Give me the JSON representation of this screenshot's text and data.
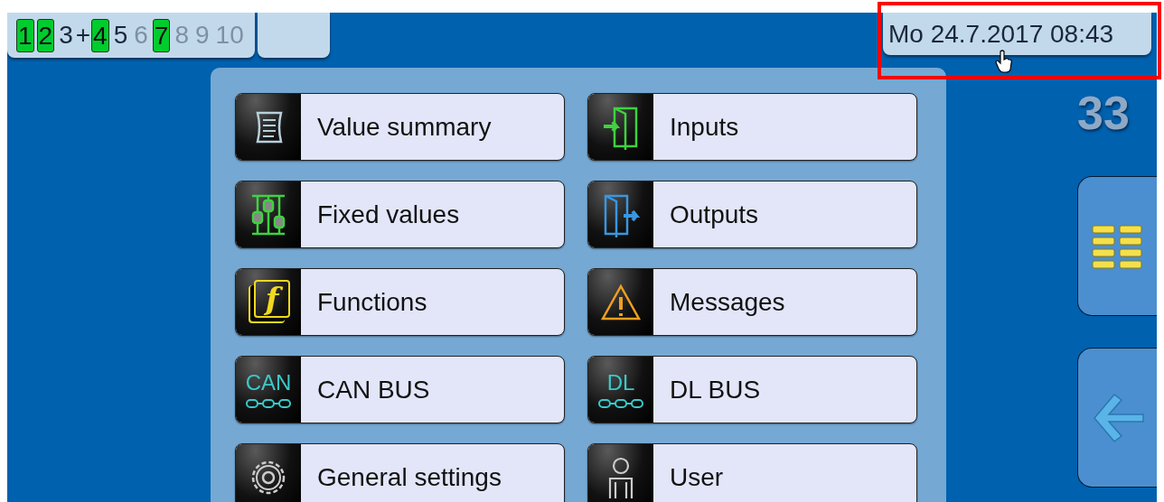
{
  "channels": [
    {
      "label": "1",
      "kind": "active"
    },
    {
      "label": "2",
      "kind": "active"
    },
    {
      "label": "3",
      "kind": "present"
    },
    {
      "label": "+",
      "kind": "joiner"
    },
    {
      "label": "4",
      "kind": "active"
    },
    {
      "label": "5",
      "kind": "present"
    },
    {
      "label": "6",
      "kind": "absent"
    },
    {
      "label": "7",
      "kind": "active"
    },
    {
      "label": "8",
      "kind": "absent"
    },
    {
      "label": "9",
      "kind": "absent"
    },
    {
      "label": "10",
      "kind": "absent"
    }
  ],
  "datetime": "Mo 24.7.2017 08:43",
  "counter": "33",
  "menu": [
    {
      "label": "Value summary",
      "kind": "summary"
    },
    {
      "label": "Inputs",
      "kind": "inputs"
    },
    {
      "label": "Fixed values",
      "kind": "fixed"
    },
    {
      "label": "Outputs",
      "kind": "outputs"
    },
    {
      "label": "Functions",
      "kind": "functions",
      "icon_text": "f"
    },
    {
      "label": "Messages",
      "kind": "messages"
    },
    {
      "label": "CAN BUS",
      "kind": "bus",
      "icon_text": "CAN"
    },
    {
      "label": "DL BUS",
      "kind": "bus",
      "icon_text": "DL"
    },
    {
      "label": "General settings",
      "kind": "settings"
    },
    {
      "label": "User",
      "kind": "user"
    }
  ],
  "side_buttons": [
    {
      "kind": "list"
    },
    {
      "kind": "back"
    }
  ]
}
